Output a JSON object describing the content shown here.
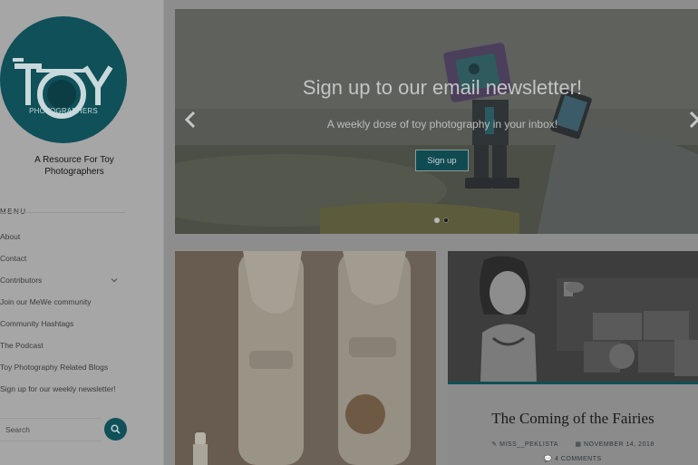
{
  "site": {
    "logo_text": "TOY",
    "logo_subtext": "PHOTOGRAPHERS",
    "tagline": "A Resource For Toy Photographers"
  },
  "sidebar": {
    "menu_heading": "MENU",
    "items": [
      {
        "label": "About"
      },
      {
        "label": "Contact"
      },
      {
        "label": "Contributors",
        "has_submenu": true
      },
      {
        "label": "Join our MeWe community"
      },
      {
        "label": "Community Hashtags"
      },
      {
        "label": "The Podcast"
      },
      {
        "label": "Toy Photography Related Blogs"
      },
      {
        "label": "Sign up for our weekly newsletter!"
      }
    ],
    "search": {
      "placeholder": "Search",
      "button_icon": "search-icon"
    }
  },
  "hero": {
    "title": "Sign up to our email newsletter!",
    "subtitle": "A weekly dose of toy photography in your inbox!",
    "button_label": "Sign up",
    "slide_count": 2,
    "active_slide": 2
  },
  "posts": [
    {
      "title": "",
      "image": "stormtrooper-bb8-photo"
    },
    {
      "title": "The Coming of the Fairies",
      "author": "MISS__PEKLISTA",
      "date": "NOVEMBER 14, 2018",
      "comments": "4 COMMENTS",
      "image": "lego-girl-fairies-photo"
    }
  ],
  "colors": {
    "accent": "#0f5059",
    "overlay": "#7c7c7c"
  }
}
